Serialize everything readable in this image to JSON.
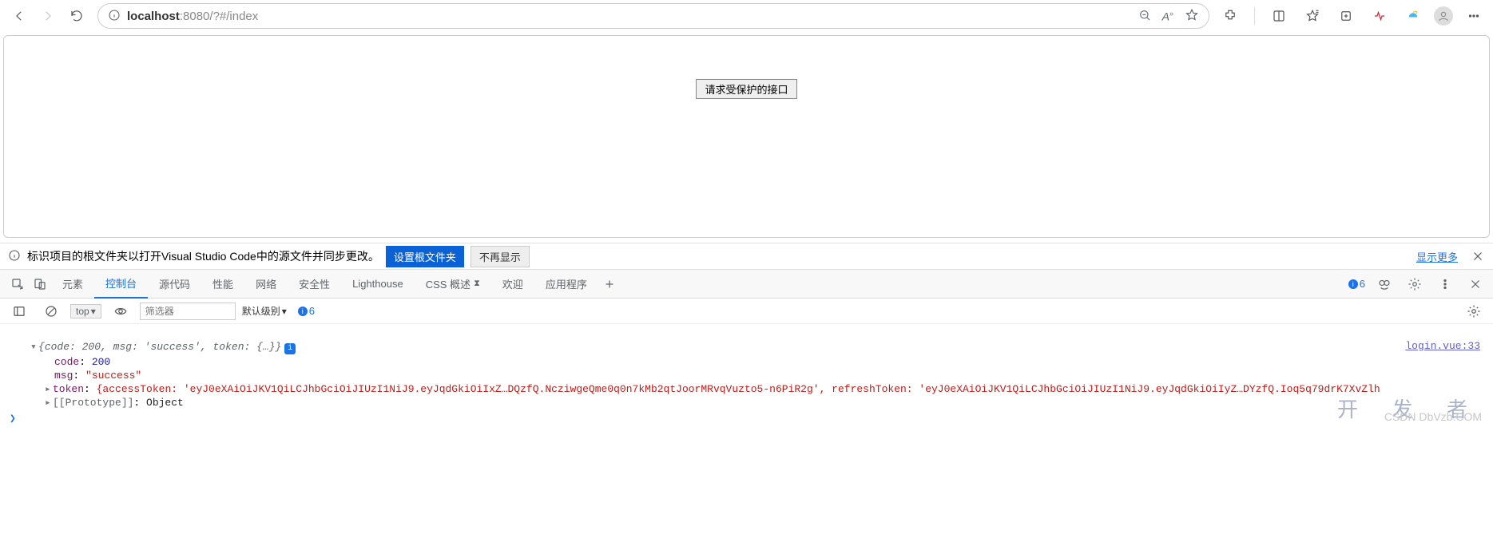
{
  "browser": {
    "url_host": "localhost",
    "url_rest": ":8080/?#/index"
  },
  "page": {
    "button_label": "请求受保护的接口"
  },
  "banner": {
    "text": "标识项目的根文件夹以打开Visual Studio Code中的源文件并同步更改。",
    "primary": "设置根文件夹",
    "secondary": "不再显示",
    "more": "显示更多"
  },
  "devtools": {
    "tabs": [
      "元素",
      "控制台",
      "源代码",
      "性能",
      "网络",
      "安全性",
      "Lighthouse",
      "CSS 概述",
      "欢迎",
      "应用程序"
    ],
    "active_index": 1,
    "css_badge": "⧗",
    "right_count": "6"
  },
  "consoleToolbar": {
    "context": "top",
    "filter_placeholder": "筛选器",
    "level": "默认级别",
    "msg_count": "6"
  },
  "log": {
    "source_link": "login.vue:33",
    "summary_open": "{",
    "summary_code_k": "code: ",
    "summary_code_v": "200",
    "summary_sep1": ", ",
    "summary_msg_k": "msg: ",
    "summary_msg_v": "'success'",
    "summary_sep2": ", ",
    "summary_token_k": "token: ",
    "summary_token_v": "{…}",
    "summary_close": "}",
    "line_code_k": "code",
    "line_code_c": ": ",
    "line_code_v": "200",
    "line_msg_k": "msg",
    "line_msg_c": ": ",
    "line_msg_v": "\"success\"",
    "line_token_k": "token",
    "line_token_c": ": ",
    "line_token_v": "{accessToken: 'eyJ0eXAiOiJKV1QiLCJhbGciOiJIUzI1NiJ9.eyJqdGkiOiIxZ…DQzfQ.NcziwgeQme0q0n7kMb2qtJoorMRvqVuzto5-n6PiR2g', refreshToken: 'eyJ0eXAiOiJKV1QiLCJhbGciOiJIUzI1NiJ9.eyJqdGkiOiIyZ…DYzfQ.Ioq5q79drK7XvZlh",
    "line_proto_k": "[[Prototype]]",
    "line_proto_c": ": ",
    "line_proto_v": "Object"
  },
  "watermark": {
    "big": "开 发 者",
    "small": "CSDN DbVzb.COM"
  }
}
